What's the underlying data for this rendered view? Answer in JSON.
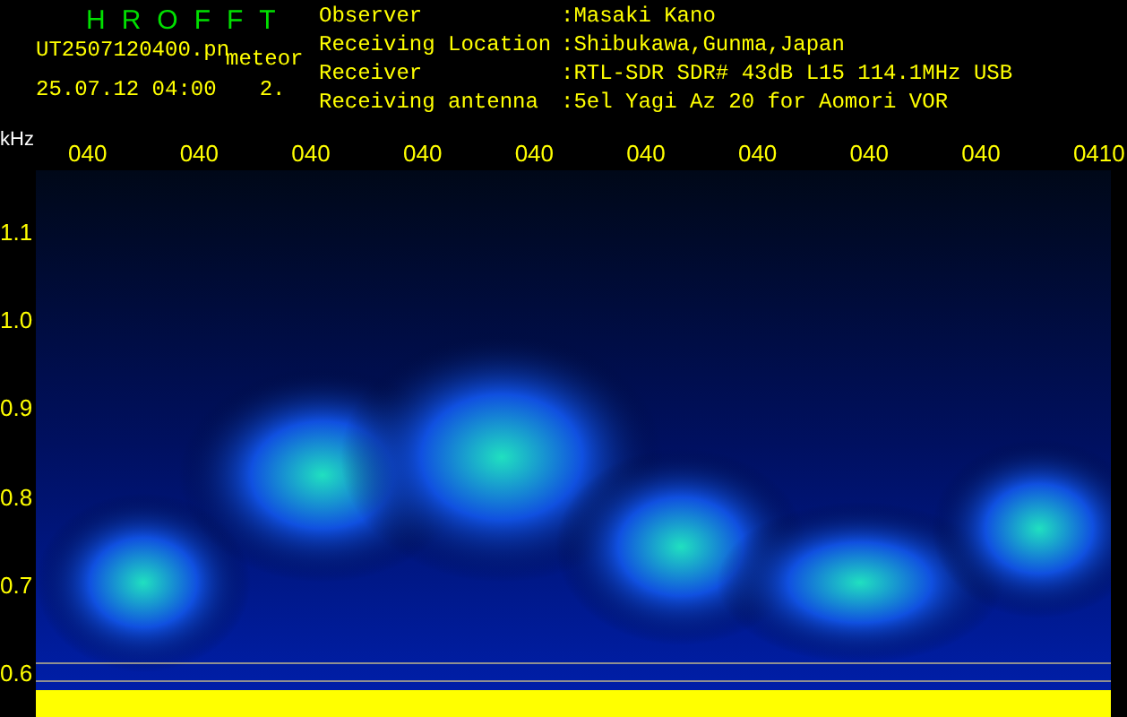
{
  "app_title": "HROFFT",
  "file": {
    "name": "UT2507120400.pn",
    "mode": "meteor",
    "datetime": "25.07.12 04:00",
    "value": "2."
  },
  "info": [
    {
      "label": "Observer",
      "value": ":Masaki Kano"
    },
    {
      "label": "Receiving Location",
      "value": ":Shibukawa,Gunma,Japan"
    },
    {
      "label": "Receiver",
      "value": ":RTL-SDR SDR# 43dB L15 114.1MHz USB"
    },
    {
      "label": "Receiving antenna",
      "value": ":5el Yagi Az 20 for Aomori VOR"
    }
  ],
  "y_unit": "kHz",
  "time_labels": [
    "040",
    "040",
    "040",
    "040",
    "040",
    "040",
    "040",
    "040",
    "040",
    "0410"
  ],
  "y_labels": [
    "1.1",
    "1.0",
    "0.9",
    "0.8",
    "0.7",
    "0.6"
  ]
}
